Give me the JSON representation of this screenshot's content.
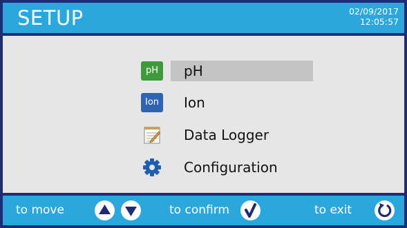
{
  "header": {
    "title": "SETUP",
    "date": "02/09/2017",
    "time": "12:05:57"
  },
  "menu": {
    "items": [
      {
        "label": "pH",
        "icon": "ph-icon",
        "badge": "pH",
        "selected": true
      },
      {
        "label": "Ion",
        "icon": "ion-icon",
        "badge": "Ion",
        "selected": false
      },
      {
        "label": "Data Logger",
        "icon": "notepad-icon",
        "selected": false
      },
      {
        "label": "Configuration",
        "icon": "gear-icon",
        "selected": false
      }
    ]
  },
  "footer": {
    "move_label": "to move",
    "confirm_label": "to confirm",
    "exit_label": "to exit"
  },
  "colors": {
    "accent": "#2aa7dc",
    "border": "#1f2b73",
    "background": "#e6e6e6",
    "highlight": "#c4c4c4",
    "ph_badge": "#3e9a3a",
    "ion_badge": "#2f63b4"
  }
}
